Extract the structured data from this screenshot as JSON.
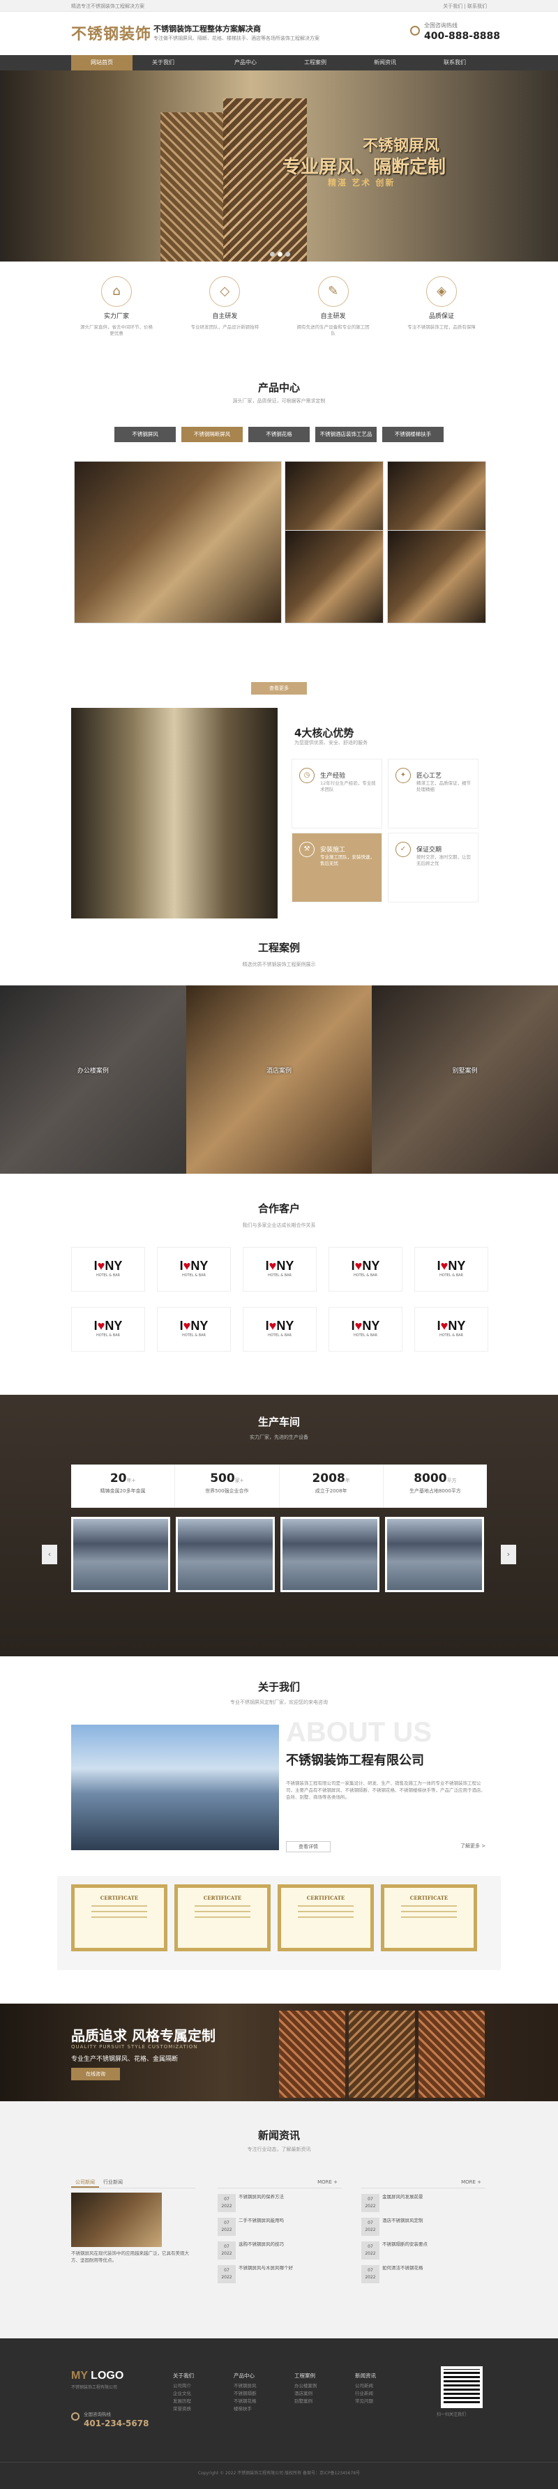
{
  "topbar": {
    "left": "精选专注不锈钢装饰工程解决方案",
    "right": "关于我们 | 联系我们"
  },
  "header": {
    "logo": "不锈钢装饰",
    "slogan": "不锈钢装饰工程整体方案解决商",
    "slogan_sub": "专注做不锈钢屏风、隔断、花格、楼梯扶手、酒店等各场所装饰工程解决方案",
    "hotline_label": "全国咨询热线",
    "hotline": "400-888-8888"
  },
  "nav": [
    "网站首页",
    "关于我们",
    "产品中心",
    "工程案例",
    "新闻资讯",
    "联系我们"
  ],
  "banner": {
    "t1": "不锈钢屏风",
    "t2": "专业屏风、隔断定制",
    "t3": "精湛 艺术 创新"
  },
  "features": [
    {
      "icon": "factory-icon",
      "title": "实力厂家",
      "desc": "源头厂家直供，省去中间环节，价格更优惠"
    },
    {
      "icon": "diamond-icon",
      "title": "自主研发",
      "desc": "专业研发团队，产品设计新颖独特"
    },
    {
      "icon": "design-icon",
      "title": "自主研发",
      "desc": "拥有先进的生产设备和专业的施工团队"
    },
    {
      "icon": "shield-icon",
      "title": "品质保证",
      "desc": "专注不锈钢装饰工程，品质有保障"
    }
  ],
  "products": {
    "title": "产品中心",
    "sub": "源头厂家，品质保证，可根据客户需求定制",
    "tabs": [
      "不锈钢屏风",
      "不锈钢隔断屏风",
      "不锈钢花格",
      "不锈钢酒店装饰工艺品",
      "不锈钢楼梯扶手"
    ],
    "more": "查看更多"
  },
  "advantages": {
    "title": "4大核心优势",
    "sub": "为您提供优质、安全、舒适的服务",
    "items": [
      {
        "title": "生产经验",
        "desc": "12年行业生产经验，专业技术团队"
      },
      {
        "title": "匠心工艺",
        "desc": "精湛工艺，品质保证，细节处理精细"
      },
      {
        "title": "安装施工",
        "desc": "专业施工团队，安装快速，售后无忧"
      },
      {
        "title": "保证交期",
        "desc": "按时交货，准时交期，让您无后顾之忧"
      }
    ]
  },
  "cases": {
    "title": "工程案例",
    "sub": "精选优质不锈钢装饰工程案例展示",
    "items": [
      "办公楼案例",
      "酒店案例",
      "别墅案例"
    ]
  },
  "partners": {
    "title": "合作客户",
    "sub": "我们与多家企业达成长期合作关系",
    "logo_text": "I♥NY",
    "logo_sub": "HOTEL & BAR"
  },
  "workshop": {
    "title": "生产车间",
    "sub": "实力厂家，先进的生产设备",
    "stats": [
      {
        "n": "20",
        "u": "年+",
        "d": "精铸金属20多年金属"
      },
      {
        "n": "500",
        "u": "家+",
        "d": "世界500强企业合作"
      },
      {
        "n": "2008",
        "u": "年",
        "d": "成立于2008年"
      },
      {
        "n": "8000",
        "u": "平方",
        "d": "生产基地占地8000平方"
      }
    ]
  },
  "about": {
    "title": "关于我们",
    "sub": "专业不锈钢屏风定制厂家，欢迎您的来电咨询",
    "big": "ABOUT US",
    "company": "不锈钢装饰工程有限公司",
    "desc": "不锈钢装饰工程有限公司是一家集设计、研发、生产、销售及施工为一体的专业不锈钢装饰工程公司，主要产品有不锈钢屏风、不锈钢隔断、不锈钢花格、不锈钢楼梯扶手等，产品广泛应用于酒店、会所、别墅、商场等各类场所。",
    "btn": "查看详情",
    "more": "了解更多 >",
    "cert": "CERTIFICATE"
  },
  "quality": {
    "title": "品质追求 风格专属定制",
    "sub": "QUALITY PURSUIT STYLE CUSTOMIZATION",
    "desc": "专业生产不锈钢屏风、花格、金属隔断",
    "btn": "在线咨询"
  },
  "news": {
    "title": "新闻资讯",
    "sub": "专注行业动态，了解最新资讯",
    "cols": [
      {
        "tabs": [
          "公司新闻",
          "行业新闻"
        ],
        "txt": "不锈钢屏风在现代装饰中的应用越来越广泛，它具有美观大方、坚固耐用等优点。"
      },
      {
        "items": [
          "不锈钢屏风的保养方法",
          "二手不锈钢屏风能用吗",
          "选购不锈钢屏风的技巧",
          "不锈钢屏风与木屏风哪个好"
        ]
      },
      {
        "items": [
          "金属屏风的发展前景",
          "酒店不锈钢屏风定制",
          "不锈钢隔断的安装要点",
          "如何清洁不锈钢花格"
        ]
      }
    ],
    "more": "MORE +"
  },
  "footer": {
    "logo_a": "MY",
    "logo_b": "LOGO",
    "logo_sub": "不锈钢装饰工程有限公司",
    "tel_label": "全国咨询热线",
    "tel": "401-234-5678",
    "cols": [
      {
        "h": "关于我们",
        "items": [
          "公司简介",
          "企业文化",
          "发展历程",
          "荣誉资质"
        ]
      },
      {
        "h": "产品中心",
        "items": [
          "不锈钢屏风",
          "不锈钢隔断",
          "不锈钢花格",
          "楼梯扶手"
        ]
      },
      {
        "h": "工程案例",
        "items": [
          "办公楼案例",
          "酒店案例",
          "别墅案例"
        ]
      },
      {
        "h": "新闻资讯",
        "items": [
          "公司新闻",
          "行业新闻",
          "常见问题"
        ]
      }
    ],
    "qr": "扫一扫关注我们",
    "copy": "Copyright © 2022 不锈钢装饰工程有限公司 版权所有 备案号：京ICP备12345678号"
  }
}
